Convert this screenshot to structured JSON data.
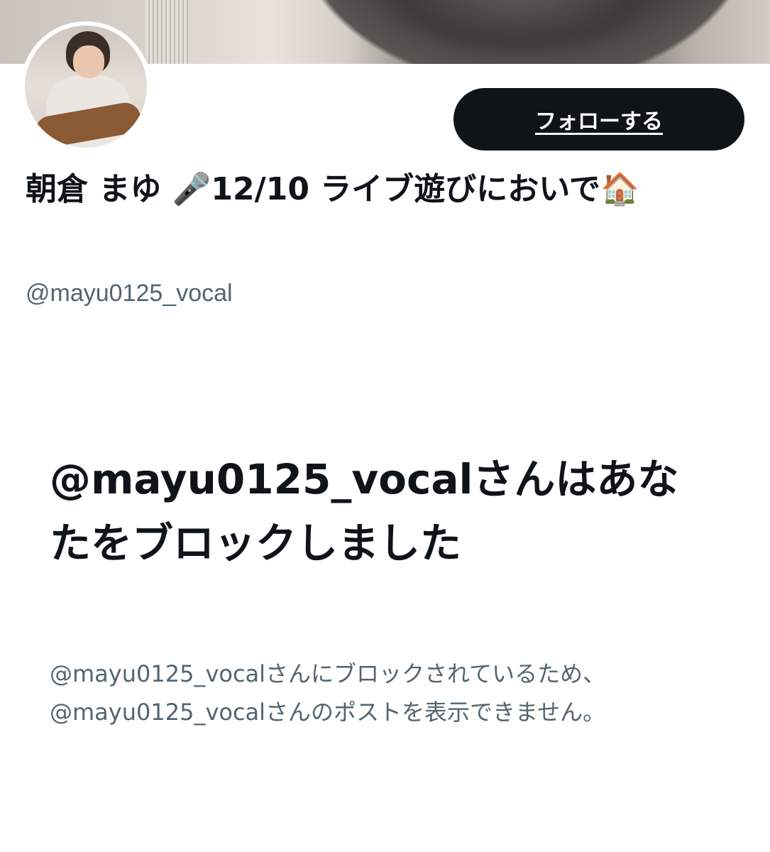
{
  "profile": {
    "display_name": "朝倉 まゆ 🎤12/10 ライブ遊びにおいで🏠",
    "handle": "@mayu0125_vocal",
    "follow_label": "フォローする"
  },
  "blocked": {
    "title": "@mayu0125_vocalさんはあなたをブロックしました",
    "desc_line1": "@mayu0125_vocalさんにブロックされているため、",
    "desc_line2": "@mayu0125_vocalさんのポストを表示できません。"
  }
}
